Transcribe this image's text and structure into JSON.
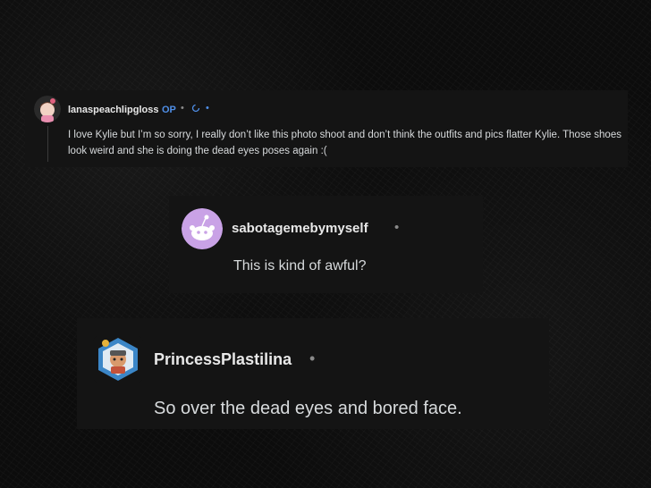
{
  "comments": [
    {
      "username": "lanaspeachlipgloss",
      "op_badge": "OP",
      "separator": "•",
      "text": "I love Kylie but I’m so sorry, I really don’t like this photo shoot and don’t think the outfits and pics flatter Kylie. Those shoes look weird and she is doing the dead eyes poses again :("
    },
    {
      "username": "sabotagemebymyself",
      "separator": "•",
      "text": "This is kind of awful?"
    },
    {
      "username": "PrincessPlastilina",
      "separator": "•",
      "text": "So over the dead eyes and bored face."
    }
  ],
  "colors": {
    "background": "#0c0c0c",
    "card": "#141414",
    "op_blue": "#4f8fe8",
    "avatar_purple": "#c9a2e6"
  }
}
